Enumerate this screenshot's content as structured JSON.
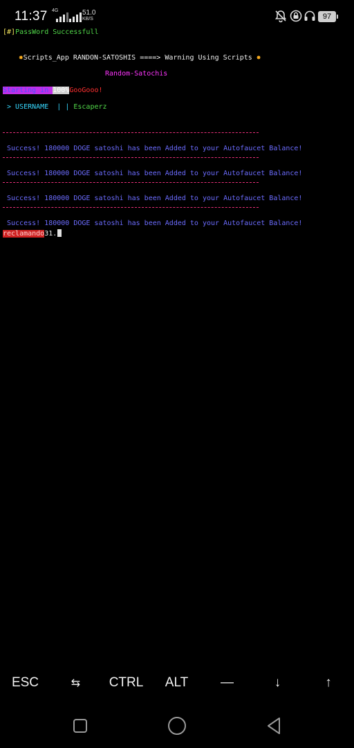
{
  "status_bar": {
    "time": "11:37",
    "network_label": "4G",
    "speed_value": "51.0",
    "speed_unit": "KB/S",
    "battery_level": "97",
    "icons": [
      "signal-icon",
      "mute-icon",
      "lock-icon",
      "headset-icon",
      "battery-icon"
    ]
  },
  "terminal": {
    "password_prefix": "[#]",
    "password_text": "PassWord Successfull",
    "banner_text": "Scripts_App RANDON-SATOSHIS ====> Warning Using Scripts",
    "subtitle": "Random-Satochis",
    "starting_text": "Starting in ",
    "starting_percent": "100%",
    "starting_suffix": "GooGooo!",
    "username_label": " > USERNAME",
    "username_separator": "  | | ",
    "username_value": "Escaperz",
    "success_lines": [
      "Success! 180000 DOGE satoshi has been Added to your Autofaucet Balance!",
      "Success! 180000 DOGE satoshi has been Added to your Autofaucet Balance!",
      "Success! 180000 DOGE satoshi has been Added to your Autofaucet Balance!",
      "Success! 180000 DOGE satoshi has been Added to your Autofaucet Balance!"
    ],
    "prompt_label": "reclamando",
    "prompt_value": "31."
  },
  "extra_keys": {
    "esc": "ESC",
    "tab": "⇆",
    "ctrl": "CTRL",
    "alt": "ALT",
    "dash": "—",
    "down": "↓",
    "up": "↑"
  },
  "colors": {
    "background": "#000000",
    "success_blue": "#6c6cff",
    "divider_pink": "#e9307a",
    "password_green": "#52d94a"
  }
}
